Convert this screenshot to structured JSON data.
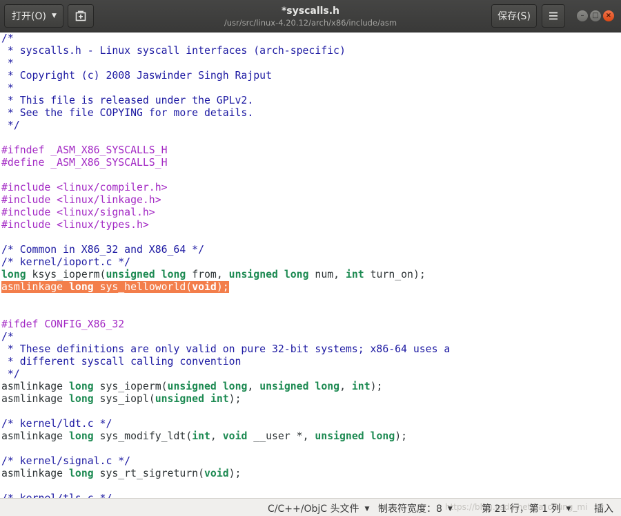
{
  "header": {
    "open_label": "打开(O)",
    "save_label": "保存(S)",
    "title": "*syscalls.h",
    "path": "/usr/src/linux-4.20.12/arch/x86/include/asm"
  },
  "editor": {
    "lines": [
      [
        {
          "t": "/*",
          "c": "c"
        }
      ],
      [
        {
          "t": " * syscalls.h - Linux syscall interfaces (arch-specific)",
          "c": "c"
        }
      ],
      [
        {
          "t": " *",
          "c": "c"
        }
      ],
      [
        {
          "t": " * Copyright (c) 2008 Jaswinder Singh Rajput",
          "c": "c"
        }
      ],
      [
        {
          "t": " *",
          "c": "c"
        }
      ],
      [
        {
          "t": " * This file is released under the GPLv2.",
          "c": "c"
        }
      ],
      [
        {
          "t": " * See the file COPYING for more details.",
          "c": "c"
        }
      ],
      [
        {
          "t": " */",
          "c": "c"
        }
      ],
      [],
      [
        {
          "t": "#ifndef _ASM_X86_SYSCALLS_H",
          "c": "p"
        }
      ],
      [
        {
          "t": "#define _ASM_X86_SYSCALLS_H",
          "c": "p"
        }
      ],
      [],
      [
        {
          "t": "#include <linux/compiler.h>",
          "c": "p"
        }
      ],
      [
        {
          "t": "#include <linux/linkage.h>",
          "c": "p"
        }
      ],
      [
        {
          "t": "#include <linux/signal.h>",
          "c": "p"
        }
      ],
      [
        {
          "t": "#include <linux/types.h>",
          "c": "p"
        }
      ],
      [],
      [
        {
          "t": "/* Common in X86_32 and X86_64 */",
          "c": "c"
        }
      ],
      [
        {
          "t": "/* kernel/ioport.c */",
          "c": "c"
        }
      ],
      [
        {
          "t": "long",
          "c": "k"
        },
        {
          "t": " ksys_ioperm("
        },
        {
          "t": "unsigned",
          "c": "k"
        },
        {
          "t": " "
        },
        {
          "t": "long",
          "c": "k"
        },
        {
          "t": " from, "
        },
        {
          "t": "unsigned",
          "c": "k"
        },
        {
          "t": " "
        },
        {
          "t": "long",
          "c": "k"
        },
        {
          "t": " num, "
        },
        {
          "t": "int",
          "c": "k"
        },
        {
          "t": " turn_on);"
        }
      ],
      {
        "hl": true,
        "spans": [
          {
            "t": "asmlinkage "
          },
          {
            "t": "long",
            "c": "k"
          },
          {
            "t": " sys_helloworld("
          },
          {
            "t": "void",
            "c": "k"
          },
          {
            "t": ");"
          }
        ]
      },
      [],
      [],
      [
        {
          "t": "#ifdef CONFIG_X86_32",
          "c": "p"
        }
      ],
      [
        {
          "t": "/*",
          "c": "c"
        }
      ],
      [
        {
          "t": " * These definitions are only valid on pure 32-bit systems; x86-64 uses a",
          "c": "c"
        }
      ],
      [
        {
          "t": " * different syscall calling convention",
          "c": "c"
        }
      ],
      [
        {
          "t": " */",
          "c": "c"
        }
      ],
      [
        {
          "t": "asmlinkage "
        },
        {
          "t": "long",
          "c": "k"
        },
        {
          "t": " sys_ioperm("
        },
        {
          "t": "unsigned",
          "c": "k"
        },
        {
          "t": " "
        },
        {
          "t": "long",
          "c": "k"
        },
        {
          "t": ", "
        },
        {
          "t": "unsigned",
          "c": "k"
        },
        {
          "t": " "
        },
        {
          "t": "long",
          "c": "k"
        },
        {
          "t": ", "
        },
        {
          "t": "int",
          "c": "k"
        },
        {
          "t": ");"
        }
      ],
      [
        {
          "t": "asmlinkage "
        },
        {
          "t": "long",
          "c": "k"
        },
        {
          "t": " sys_iopl("
        },
        {
          "t": "unsigned",
          "c": "k"
        },
        {
          "t": " "
        },
        {
          "t": "int",
          "c": "k"
        },
        {
          "t": ");"
        }
      ],
      [],
      [
        {
          "t": "/* kernel/ldt.c */",
          "c": "c"
        }
      ],
      [
        {
          "t": "asmlinkage "
        },
        {
          "t": "long",
          "c": "k"
        },
        {
          "t": " sys_modify_ldt("
        },
        {
          "t": "int",
          "c": "k"
        },
        {
          "t": ", "
        },
        {
          "t": "void",
          "c": "k"
        },
        {
          "t": " __user *, "
        },
        {
          "t": "unsigned",
          "c": "k"
        },
        {
          "t": " "
        },
        {
          "t": "long",
          "c": "k"
        },
        {
          "t": ");"
        }
      ],
      [],
      [
        {
          "t": "/* kernel/signal.c */",
          "c": "c"
        }
      ],
      [
        {
          "t": "asmlinkage "
        },
        {
          "t": "long",
          "c": "k"
        },
        {
          "t": " sys_rt_sigreturn("
        },
        {
          "t": "void",
          "c": "k"
        },
        {
          "t": ");"
        }
      ],
      [],
      [
        {
          "t": "/* kernel/tls.c */",
          "c": "c"
        }
      ]
    ]
  },
  "status": {
    "language": "C/C++/ObjC 头文件",
    "tab_width": "制表符宽度：8",
    "position": "第 21 行，第 1 列",
    "mode": "插入",
    "watermark": "https://blog.csdn.net/jia_chung_mi"
  },
  "colors": {
    "comment": "#1c19a2",
    "preprocessor": "#a329c4",
    "keyword": "#1d8a52",
    "highlight": "#f37e4b",
    "close_button": "#dd4814"
  },
  "icons": {
    "open_dropdown": "chevron-down-icon",
    "new_tab": "new-document-icon",
    "menu": "hamburger-icon",
    "minimize": "minimize-icon",
    "maximize": "maximize-icon",
    "close": "close-icon"
  }
}
